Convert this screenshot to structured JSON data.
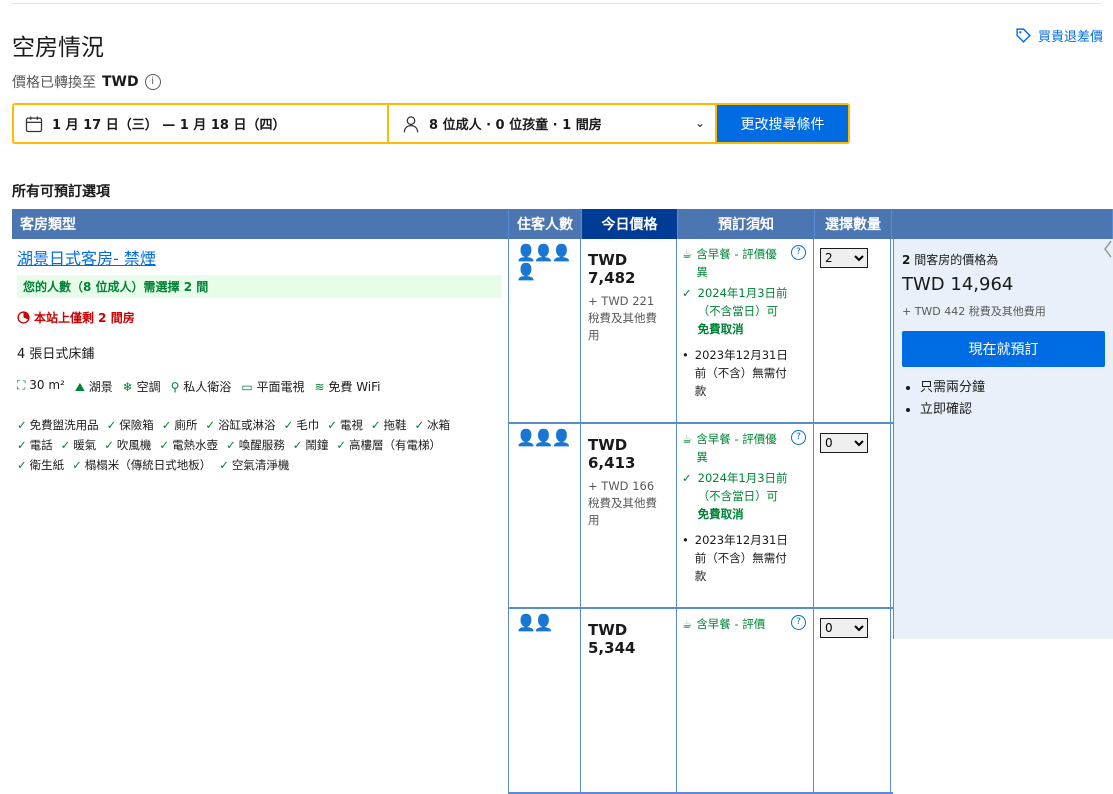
{
  "header": {
    "title": "空房情況",
    "price_match": "買貴退差價",
    "conversion_text": "價格已轉換至",
    "currency": "TWD"
  },
  "search": {
    "dates": "1 月 17 日（三） — 1 月 18 日（四）",
    "guests": "8 位成人 · 0 位孩童 · 1 間房",
    "button": "更改搜尋條件"
  },
  "all_options": "所有可預訂選項",
  "table_headers": {
    "room_type": "客房類型",
    "guests": "住客人數",
    "today_price": "今日價格",
    "policy": "預訂須知",
    "quantity": "選擇數量"
  },
  "room": {
    "name": "湖景日式客房- 禁煙",
    "fit_banner": "您的人數（8 位成人）需選擇 2 間",
    "scarcity": "本站上僅剩 2 間房",
    "beds": "4 張日式床鋪",
    "amenities": [
      "30 m²",
      "湖景",
      "空調",
      "私人衛浴",
      "平面電視",
      "免費 WiFi"
    ],
    "facilities": [
      "免費盥洗用品",
      "保險箱",
      "廁所",
      "浴缸或淋浴",
      "毛巾",
      "電視",
      "拖鞋",
      "冰箱",
      "電話",
      "暖氣",
      "吹風機",
      "電熱水壺",
      "喚醒服務",
      "鬧鐘",
      "高樓層（有電梯）",
      "衛生紙",
      "榻榻米（傳統日式地板）",
      "空氣清淨機"
    ]
  },
  "rates": [
    {
      "guests": "8888",
      "price": "TWD 7,482",
      "tax": "+ TWD 221 稅費及其他費用",
      "breakfast": "含早餐 - 評價優異",
      "cancel_date": "2024年1月3日前（不含當日）可",
      "cancel_free": "免費取消",
      "prepay": "2023年12月31日前（不含）無需付款",
      "qty": "2"
    },
    {
      "guests": "888",
      "price": "TWD 6,413",
      "tax": "+ TWD 166 稅費及其他費用",
      "breakfast": "含早餐 - 評價優異",
      "cancel_date": "2024年1月3日前（不含當日）可",
      "cancel_free": "免費取消",
      "prepay": "2023年12月31日前（不含）無需付款",
      "qty": "0"
    },
    {
      "guests": "88",
      "price": "TWD 5,344",
      "breakfast": "含早餐 - 評價",
      "qty": "0"
    }
  ],
  "summary": {
    "rooms_count": "2",
    "for_label": "間客房的價格為",
    "total": "TWD 14,964",
    "tax": "+ TWD 442 稅費及其他費用",
    "book_button": "現在就預訂",
    "bullets": [
      "只需兩分鐘",
      "立即確認"
    ]
  },
  "colors": {
    "primary": "#006ce4",
    "header": "#4c76b2",
    "header_dark": "#003b95",
    "green": "#008234",
    "yellow": "#febb02"
  }
}
